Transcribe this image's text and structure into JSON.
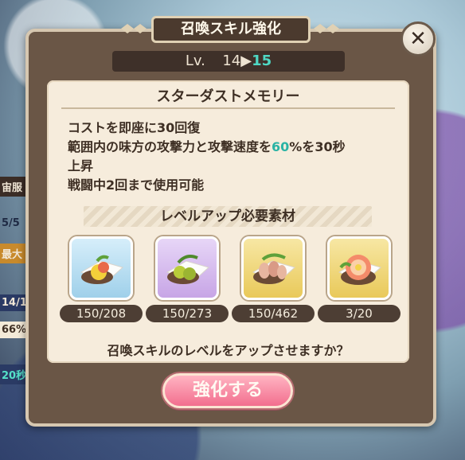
{
  "modal": {
    "title": "召喚スキル強化",
    "close_icon": "close-icon",
    "level": {
      "prefix": "Lv.",
      "current": "14",
      "arrow": "▶",
      "next": "15"
    }
  },
  "skill": {
    "name": "スターダストメモリー",
    "desc": {
      "line1": "コストを即座に30回復",
      "line2_before": "範囲内の味方の攻撃力と攻撃速度を",
      "line2_highlight": "60",
      "line2_after": "%を30秒",
      "line3": "上昇",
      "line4": "戦闘中2回まで使用可能"
    },
    "highlight_color": "#2bb3a4"
  },
  "materials": {
    "header": "レベルアップ必要素材",
    "items": [
      {
        "count": "150/208",
        "frame_color": "#9fd0ea",
        "icon": "lemon-dish-icon"
      },
      {
        "count": "150/273",
        "frame_color": "#c7a5e6",
        "icon": "olive-dish-icon"
      },
      {
        "count": "150/462",
        "frame_color": "#e9c95a",
        "icon": "bean-dish-icon"
      },
      {
        "count": "3/20",
        "frame_color": "#e9c95a",
        "icon": "flower-dish-icon"
      }
    ]
  },
  "question": "召喚スキルのレベルをアップさせますか？",
  "enhance_button": {
    "label": "強化する"
  },
  "background": {
    "left_strip": [
      "宙服",
      "5/5",
      "最大",
      "14/1",
      "66%",
      "20秒"
    ]
  }
}
